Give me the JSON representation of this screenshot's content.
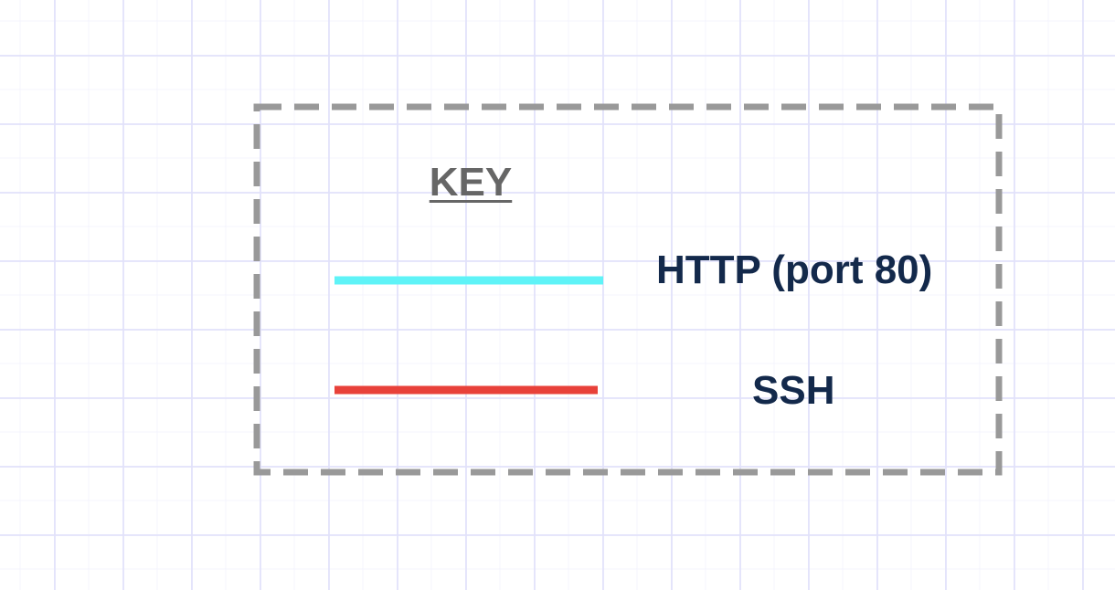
{
  "legend": {
    "title": "KEY",
    "items": [
      {
        "label": "HTTP (port 80)",
        "color": "#5ff3f7"
      },
      {
        "label": "SSH",
        "color": "#e8413a"
      }
    ]
  },
  "colors": {
    "border": "#999999",
    "label": "#13294b",
    "title": "#666666"
  }
}
